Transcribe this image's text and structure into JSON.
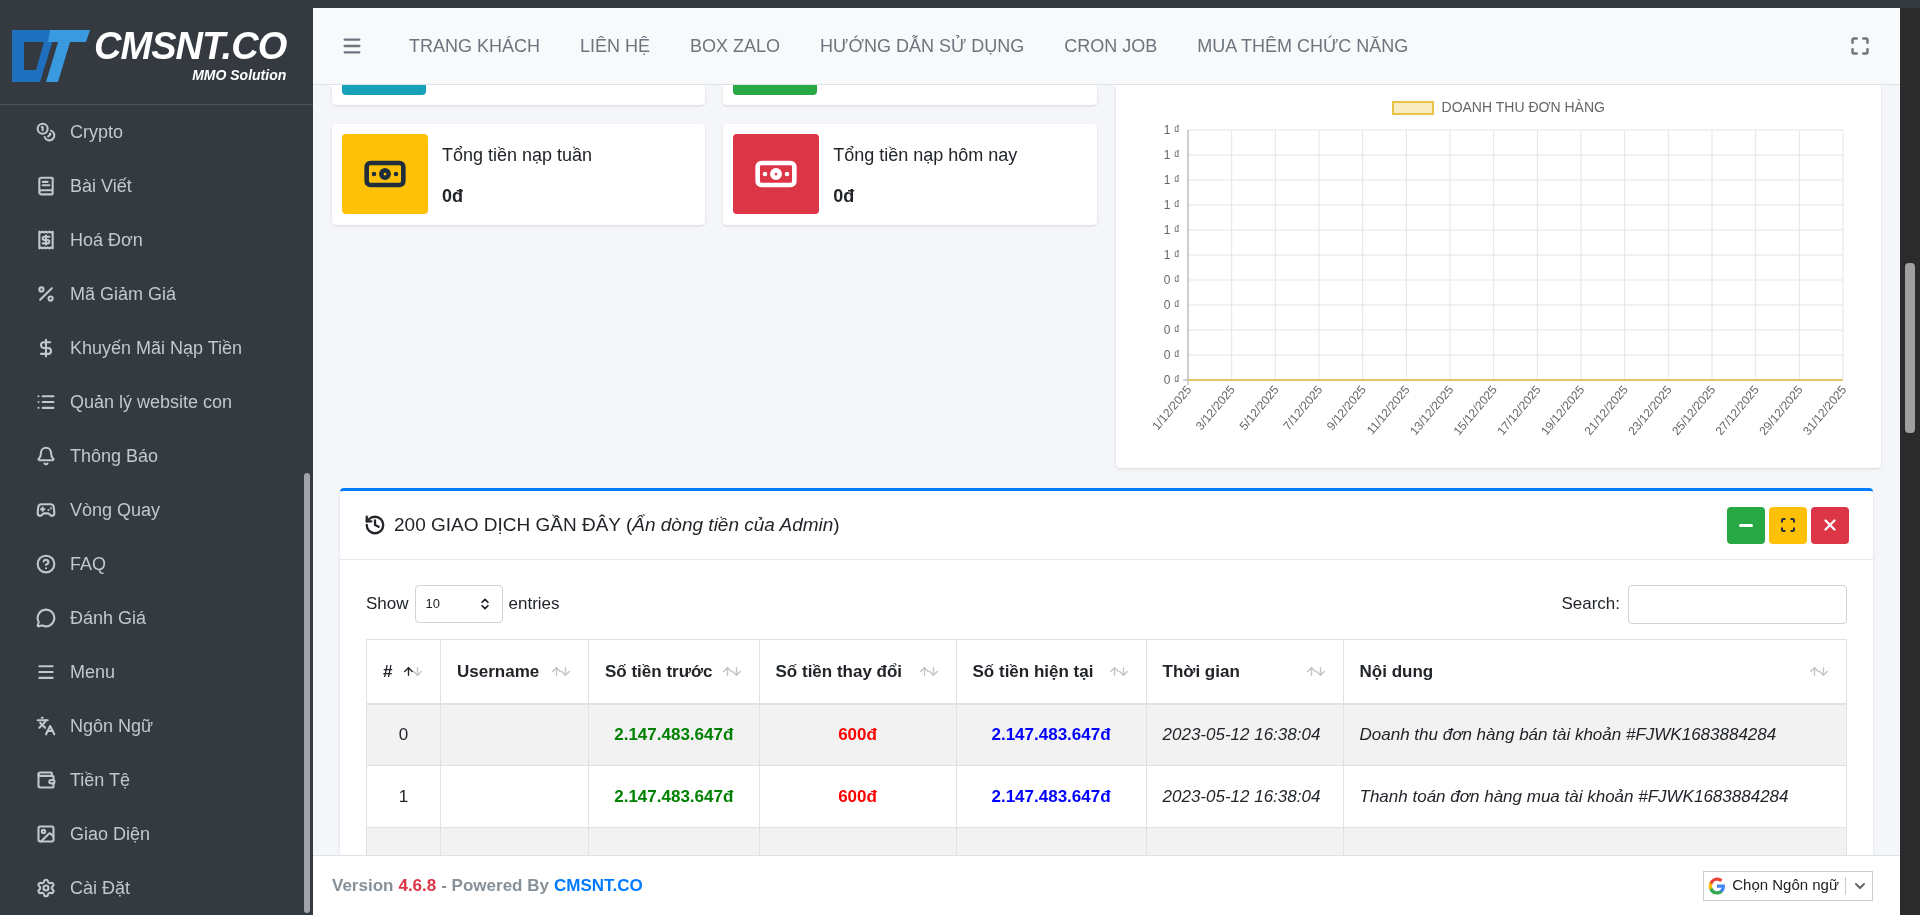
{
  "logo": {
    "text": "CMSNT.CO",
    "tagline": "MMO Solution"
  },
  "sidebar": {
    "items": [
      {
        "label": "Crypto"
      },
      {
        "label": "Bài Viết"
      },
      {
        "label": "Hoá Đơn"
      },
      {
        "label": "Mã Giảm Giá"
      },
      {
        "label": "Khuyến Mãi Nạp Tiền"
      },
      {
        "label": "Quản lý website con"
      },
      {
        "label": "Thông Báo"
      },
      {
        "label": "Vòng Quay"
      },
      {
        "label": "FAQ"
      },
      {
        "label": "Đánh Giá"
      },
      {
        "label": "Menu"
      },
      {
        "label": "Ngôn Ngữ"
      },
      {
        "label": "Tiền Tệ"
      },
      {
        "label": "Giao Diện"
      },
      {
        "label": "Cài Đặt"
      }
    ]
  },
  "navbar": {
    "items": [
      "TRANG KHÁCH",
      "LIÊN HỆ",
      "BOX ZALO",
      "HƯỚNG DẪN SỬ DỤNG",
      "CRON JOB",
      "MUA THÊM CHỨC NĂNG"
    ]
  },
  "partial_cards": [
    {
      "color": "#17a2b8"
    },
    {
      "color": "#28a745"
    }
  ],
  "stat_cards": [
    {
      "label": "Tổng tiền nạp tuần",
      "value": "0đ",
      "color": "#ffc107"
    },
    {
      "label": "Tổng tiền nạp hôm nay",
      "value": "0đ",
      "color": "#dc3545"
    }
  ],
  "chart": {
    "chart_data": {
      "type": "line",
      "categories": [
        "1/12/2025",
        "3/12/2025",
        "5/12/2025",
        "7/12/2025",
        "9/12/2025",
        "11/12/2025",
        "13/12/2025",
        "15/12/2025",
        "17/12/2025",
        "19/12/2025",
        "21/12/2025",
        "23/12/2025",
        "25/12/2025",
        "27/12/2025",
        "29/12/2025",
        "31/12/2025"
      ],
      "series": [
        {
          "name": "DOANH THU ĐƠN HÀNG",
          "color": "#e9c346",
          "values": [
            0,
            0,
            0,
            0,
            0,
            0,
            0,
            0,
            0,
            0,
            0,
            0,
            0,
            0,
            0,
            0
          ]
        }
      ],
      "ylim": [
        0,
        1
      ],
      "grid": true,
      "yticks": [
        {
          "value": 0,
          "label": "0 ₫"
        },
        {
          "value": 0.1,
          "label": "0 ₫"
        },
        {
          "value": 0.2,
          "label": "0 ₫"
        },
        {
          "value": 0.3,
          "label": "0 ₫"
        },
        {
          "value": 0.4,
          "label": "0 ₫"
        },
        {
          "value": 0.5,
          "label": "1 ₫"
        },
        {
          "value": 0.6,
          "label": "1 ₫"
        },
        {
          "value": 0.7,
          "label": "1 ₫"
        },
        {
          "value": 0.8,
          "label": "1 ₫"
        },
        {
          "value": 0.9,
          "label": "1 ₫"
        },
        {
          "value": 1,
          "label": "1 ₫"
        }
      ]
    }
  },
  "transactions": {
    "title": "200 GIAO DỊCH GẦN ĐÂY (*Ẩn dòng tiền của Admin*)",
    "show_label": "Show",
    "page_size": "10",
    "entries_label": "entries",
    "search_label": "Search:",
    "columns": [
      {
        "label": "#",
        "sorted": true
      },
      {
        "label": "Username",
        "sorted": false
      },
      {
        "label": "Số tiền trước",
        "sorted": false
      },
      {
        "label": "Số tiền thay đổi",
        "sorted": false
      },
      {
        "label": "Số tiền hiện tại",
        "sorted": false
      },
      {
        "label": "Thời gian",
        "sorted": false
      },
      {
        "label": "Nội dung",
        "sorted": false
      }
    ],
    "rows": [
      [
        "0",
        "",
        "2.147.483.647đ",
        "600đ",
        "2.147.483.647đ",
        "2023-05-12 16:38:04",
        "Doanh thu đơn hàng bán tài khoản #FJWK1683884284"
      ],
      [
        "1",
        "",
        "2.147.483.647đ",
        "600đ",
        "2.147.483.647đ",
        "2023-05-12 16:38:04",
        "Thanh toán đơn hàng mua tài khoản #FJWK1683884284"
      ]
    ]
  },
  "footer": {
    "version_label": "Version",
    "version": "4.6.8",
    "powered_by": "- Powered By",
    "link": "CMSNT.CO",
    "language_select": "Chọn Ngôn ngữ"
  }
}
